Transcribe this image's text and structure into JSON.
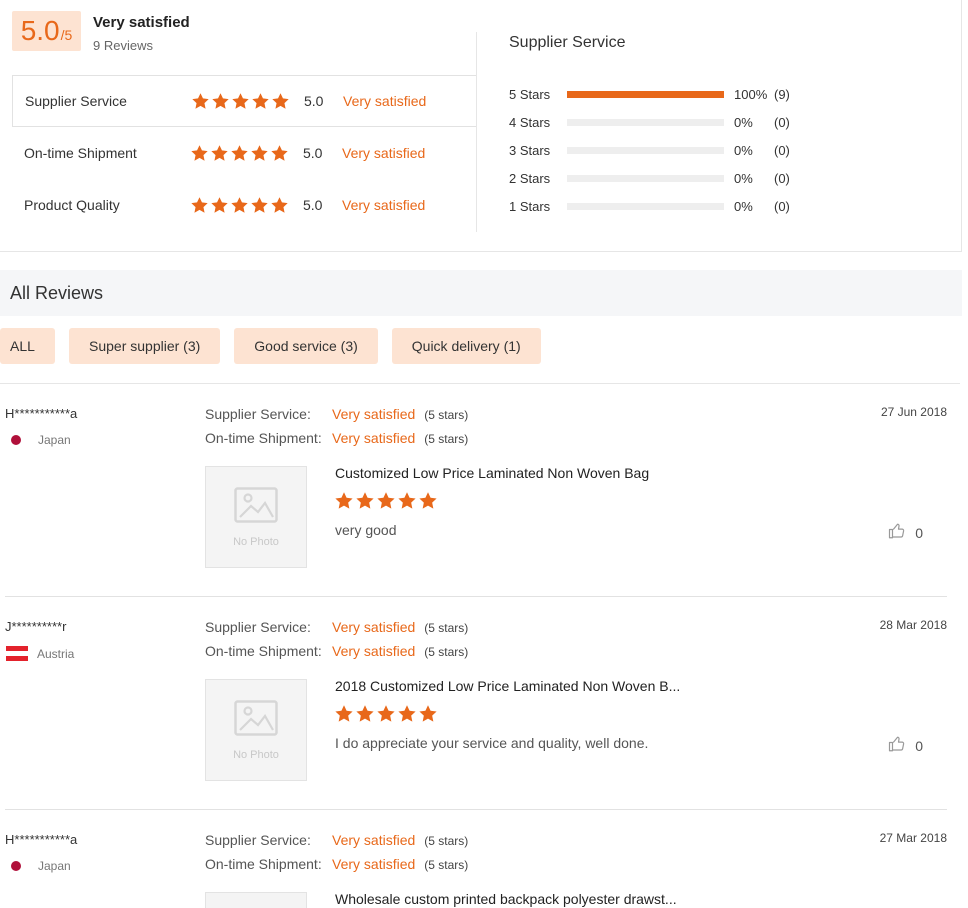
{
  "colors": {
    "accent": "#e8681a",
    "badge_bg": "#fde3d2",
    "header_bg": "#f5f6f8"
  },
  "summary": {
    "score": "5.0",
    "score_max": "/5",
    "label": "Very satisfied",
    "reviews": "9 Reviews",
    "ratings": [
      {
        "name": "Supplier Service",
        "score": "5.0",
        "text": "Very satisfied",
        "stars": 5
      },
      {
        "name": "On-time Shipment",
        "score": "5.0",
        "text": "Very satisfied",
        "stars": 5
      },
      {
        "name": "Product Quality",
        "score": "5.0",
        "text": "Very satisfied",
        "stars": 5
      }
    ]
  },
  "distribution": {
    "title": "Supplier Service",
    "rows": [
      {
        "label": "5  Stars",
        "pct": "100%",
        "count": "(9)",
        "fill": 1.0
      },
      {
        "label": "4  Stars",
        "pct": "0%",
        "count": "(0)",
        "fill": 0
      },
      {
        "label": "3  Stars",
        "pct": "0%",
        "count": "(0)",
        "fill": 0
      },
      {
        "label": "2  Stars",
        "pct": "0%",
        "count": "(0)",
        "fill": 0
      },
      {
        "label": "1  Stars",
        "pct": "0%",
        "count": "(0)",
        "fill": 0
      }
    ]
  },
  "all_reviews": {
    "title": "All Reviews",
    "filters": [
      "ALL",
      "Super supplier (3)",
      "Good service (3)",
      "Quick delivery (1)"
    ],
    "no_photo": "No Photo",
    "items": [
      {
        "buyer": "H***********a",
        "country": "Japan",
        "flag": "japan",
        "date": "27 Jun 2018",
        "lines": [
          {
            "name": "Supplier Service:",
            "text": "Very satisfied",
            "stars": "(5 stars)"
          },
          {
            "name": "On-time Shipment:",
            "text": "Very satisfied",
            "stars": "(5 stars)"
          }
        ],
        "product": "Customized Low Price Laminated Non Woven Bag",
        "comment": "very good",
        "likes": "0"
      },
      {
        "buyer": "J**********r",
        "country": "Austria",
        "flag": "austria",
        "date": "28 Mar 2018",
        "lines": [
          {
            "name": "Supplier Service:",
            "text": "Very satisfied",
            "stars": "(5 stars)"
          },
          {
            "name": "On-time Shipment:",
            "text": "Very satisfied",
            "stars": "(5 stars)"
          }
        ],
        "product": "2018 Customized Low Price Laminated Non Woven B...",
        "comment": "I do appreciate your service and quality, well done.",
        "likes": "0"
      },
      {
        "buyer": "H***********a",
        "country": "Japan",
        "flag": "japan",
        "date": "27 Mar 2018",
        "lines": [
          {
            "name": "Supplier Service:",
            "text": "Very satisfied",
            "stars": "(5 stars)"
          },
          {
            "name": "On-time Shipment:",
            "text": "Very satisfied",
            "stars": "(5 stars)"
          }
        ],
        "product": "Wholesale custom printed backpack polyester drawst..."
      }
    ]
  }
}
